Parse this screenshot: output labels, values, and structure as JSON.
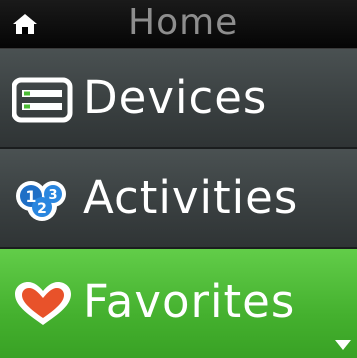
{
  "header": {
    "title": "Home",
    "icon": "home-icon"
  },
  "menu": {
    "items": [
      {
        "label": "Devices",
        "icon": "devices-icon",
        "selected": false
      },
      {
        "label": "Activities",
        "icon": "activities-icon",
        "selected": false
      },
      {
        "label": "Favorites",
        "icon": "heart-icon",
        "selected": true
      }
    ]
  },
  "scroll": {
    "icon": "scroll-down-icon"
  },
  "colors": {
    "background": "#000000",
    "item_bg": "#3f4546",
    "selected_bg": "#4cbb36",
    "header_text": "#8e8e8e",
    "heart": "#e8522a"
  }
}
